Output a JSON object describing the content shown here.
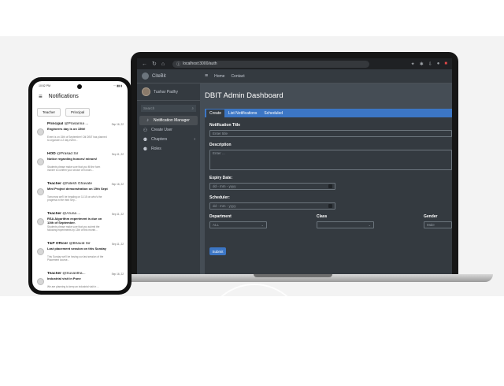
{
  "laptop": {
    "browser": {
      "nav_glyphs": [
        "←",
        "↻",
        "⌂",
        "ⓘ"
      ],
      "url": "localhost:3000/auth"
    },
    "sidebar": {
      "brand": "CiteBit",
      "user_name": "Tushar Padhy",
      "search_placeholder": "Search",
      "items": [
        {
          "label": "Notification Manager",
          "icon": "bell-icon"
        },
        {
          "label": "Create User",
          "icon": "user-plus-icon"
        },
        {
          "label": "Chapters",
          "icon": "users-icon"
        },
        {
          "label": "Roles",
          "icon": "user-tag-icon"
        }
      ]
    },
    "topbar": {
      "links": [
        "Home",
        "Contact"
      ]
    },
    "page_title": "DBIT Admin Dashboard",
    "tabs": [
      "Create",
      "List Notifications",
      "Scheduled"
    ],
    "form": {
      "title_label": "Notification Title",
      "title_placeholder": "Enter title",
      "description_label": "Description",
      "description_placeholder": "Enter ...",
      "expiry_label": "Expiry Date:",
      "expiry_placeholder": "dd - mm - yyyy",
      "scheduler_label": "Scheduler:",
      "scheduler_placeholder": "dd - mm - yyyy",
      "department_label": "Department",
      "department_value": "ALL",
      "class_label": "Class",
      "class_value": "",
      "gender_label": "Gender",
      "gender_value": "Male",
      "submit_label": "Submit"
    },
    "colors": {
      "accent": "#3c76c5",
      "sidebar_bg": "#343a40",
      "content_bg": "#454d55"
    }
  },
  "phone": {
    "status_time": "10:52 PM",
    "status_icons": "⋯ ▮▮ ▮",
    "title": "Notifications",
    "filters": [
      "Teacher",
      "Principal"
    ],
    "notifications": [
      {
        "role": "Principal",
        "handle": "@Prasanna ...",
        "date": "Sep 16, 22",
        "title": "Engineers day is on 15th!",
        "body": "Event is on 15th of September! Citi DBIT has planned to organize a 2 day event..."
      },
      {
        "role": "HOD",
        "handle": "@Prasad Sir",
        "date": "Sep 11, 22",
        "title": "Notice regarding honors/ minors!",
        "body": "Students please make sure that you fill the form inorder to confirm your choice of honors..."
      },
      {
        "role": "Teacher",
        "handle": "@Nilesh Ghavate",
        "date": "Sep 16, 22",
        "title": "Mini Project demonstration on 15th Sept",
        "body": "Tomorrow we'll be heading on 11:15 on who's the progress in the third Sep..."
      },
      {
        "role": "Teacher",
        "handle": "@Aruna ...",
        "date": "Sep 11, 22",
        "title": "RSA Algorithm experiment is due on 13th of September.",
        "body": "Students please make sure that you submit the following experiments by 13th of this month..."
      },
      {
        "role": "T&P Officer",
        "handle": "@Bhavat Sir",
        "date": "Sep 11, 22",
        "title": "Last placement session on this Sunday",
        "body": "This Sunday we'll be having our last session of the Placement course..."
      },
      {
        "role": "Teacher",
        "handle": "@Suvantha...",
        "date": "Sep 16, 22",
        "title": "Industrial visit in Pune",
        "body": "We are planning to keep an industrial visit in ..."
      }
    ]
  }
}
